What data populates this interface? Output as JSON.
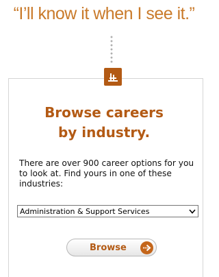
{
  "quote": "“I’ll know it when I see it.”",
  "card": {
    "icon": "toolbox-icon",
    "headline_line1": "Browse careers",
    "headline_line2": "by industry.",
    "intro_text": "There are over 900 career options for you to look at. Find yours in one of these industries:",
    "industry_select": {
      "selected": "Administration & Support Services"
    },
    "browse_button": {
      "label": "Browse",
      "icon": "arrow-right-circle-icon"
    }
  },
  "colors": {
    "accent_orange": "#b35a14",
    "quote_orange": "#c97a2a",
    "border_gray": "#d5d5d5"
  }
}
